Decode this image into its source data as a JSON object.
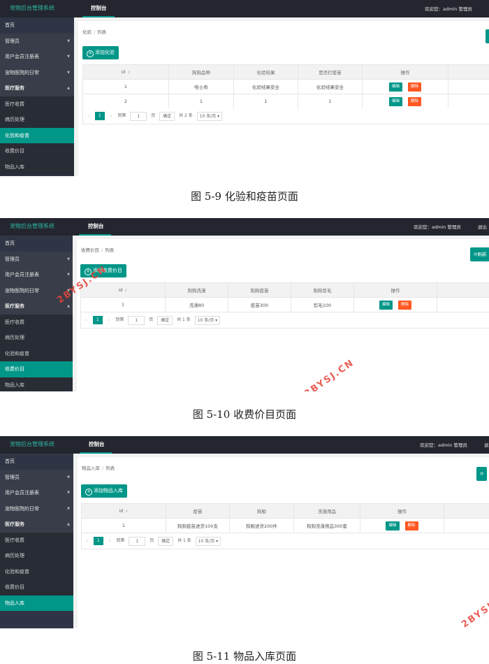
{
  "common": {
    "app_title": "宠物后台管理系统",
    "top_tab": "控制台",
    "welcome": "欢迎您：admin 管理员",
    "logout": "退出",
    "refresh": "刷新",
    "btn_edit": "编辑",
    "btn_delete": "删除",
    "pager": {
      "goto": "到第",
      "page": "页",
      "confirm": "确定",
      "size": "10 条/页",
      "page_no": "1",
      "input": "1"
    }
  },
  "figures": [
    {
      "sidebar": [
        {
          "label": "首页",
          "kind": "top"
        },
        {
          "label": "管理员",
          "kind": "group",
          "caret": "▼"
        },
        {
          "label": "用户会员注册表",
          "kind": "group",
          "caret": "▼"
        },
        {
          "label": "宠物医院的日常",
          "kind": "group",
          "caret": "▼"
        },
        {
          "label": "医疗服务",
          "kind": "group-open",
          "caret": "▲"
        },
        {
          "label": "医疗收费",
          "kind": "sub"
        },
        {
          "label": "病历处理",
          "kind": "sub"
        },
        {
          "label": "化验和疫苗",
          "kind": "active"
        },
        {
          "label": "收费价目",
          "kind": "sub"
        },
        {
          "label": "物品入库",
          "kind": "sub"
        }
      ],
      "breadcrumb": [
        "化验",
        "列表"
      ],
      "add_button": "添加化验",
      "columns": [
        "id",
        "狗狗品种",
        "化验结果",
        "是否打疫苗",
        "操作"
      ],
      "rows": [
        [
          "1",
          "哈士奇",
          "化验结果安全",
          "化验结果安全"
        ],
        [
          "2",
          "1",
          "1",
          "1"
        ]
      ],
      "total": "共 2 条",
      "caption": "图 5-9 化验和疫苗页面"
    },
    {
      "sidebar": [
        {
          "label": "首页",
          "kind": "top"
        },
        {
          "label": "管理员",
          "kind": "group",
          "caret": "▼"
        },
        {
          "label": "用户会员注册表",
          "kind": "group",
          "caret": "▼"
        },
        {
          "label": "宠物医院的日常",
          "kind": "group",
          "caret": "▼"
        },
        {
          "label": "医疗服务",
          "kind": "group-open",
          "caret": "▲"
        },
        {
          "label": "医疗收费",
          "kind": "sub"
        },
        {
          "label": "病历处理",
          "kind": "sub"
        },
        {
          "label": "化验和疫苗",
          "kind": "sub"
        },
        {
          "label": "收费价目",
          "kind": "active"
        },
        {
          "label": "物品入库",
          "kind": "sub"
        }
      ],
      "breadcrumb": [
        "收费价目",
        "列表"
      ],
      "add_button": "添加收费价目",
      "columns": [
        "id",
        "狗狗洗澡",
        "狗狗疫苗",
        "狗狗剪毛",
        "操作"
      ],
      "rows": [
        [
          "1",
          "洗澡80",
          "疫苗300",
          "剪毛100"
        ]
      ],
      "total": "共 1 条",
      "caption": "图 5-10 收费价目页面"
    },
    {
      "sidebar": [
        {
          "label": "首页",
          "kind": "top"
        },
        {
          "label": "管理员",
          "kind": "group",
          "caret": "▼"
        },
        {
          "label": "用户会员注册表",
          "kind": "group",
          "caret": "▼"
        },
        {
          "label": "宠物医院的日常",
          "kind": "group",
          "caret": "▼"
        },
        {
          "label": "医疗服务",
          "kind": "group-open",
          "caret": "▲"
        },
        {
          "label": "医疗收费",
          "kind": "sub"
        },
        {
          "label": "病历处理",
          "kind": "sub"
        },
        {
          "label": "化验和疫苗",
          "kind": "sub"
        },
        {
          "label": "收费价目",
          "kind": "sub"
        },
        {
          "label": "物品入库",
          "kind": "active"
        }
      ],
      "breadcrumb": [
        "物品入库",
        "列表"
      ],
      "add_button": "添加物品入库",
      "columns": [
        "id",
        "疫苗",
        "狗粮",
        "洗澡用品",
        "操作"
      ],
      "rows": [
        [
          "1",
          "狗狗疫苗进货100支",
          "狗粮进货200件",
          "狗狗洗澡用品300套"
        ]
      ],
      "total": "共 1 条",
      "caption": "图 5-11 物品入库页面"
    }
  ],
  "watermark": "2BYSJ.CN",
  "colors": {
    "topbar": "#23262e",
    "sidebar": "#2f3544",
    "accent": "#009688",
    "danger": "#ff5722",
    "watermark": "#e8443a"
  }
}
